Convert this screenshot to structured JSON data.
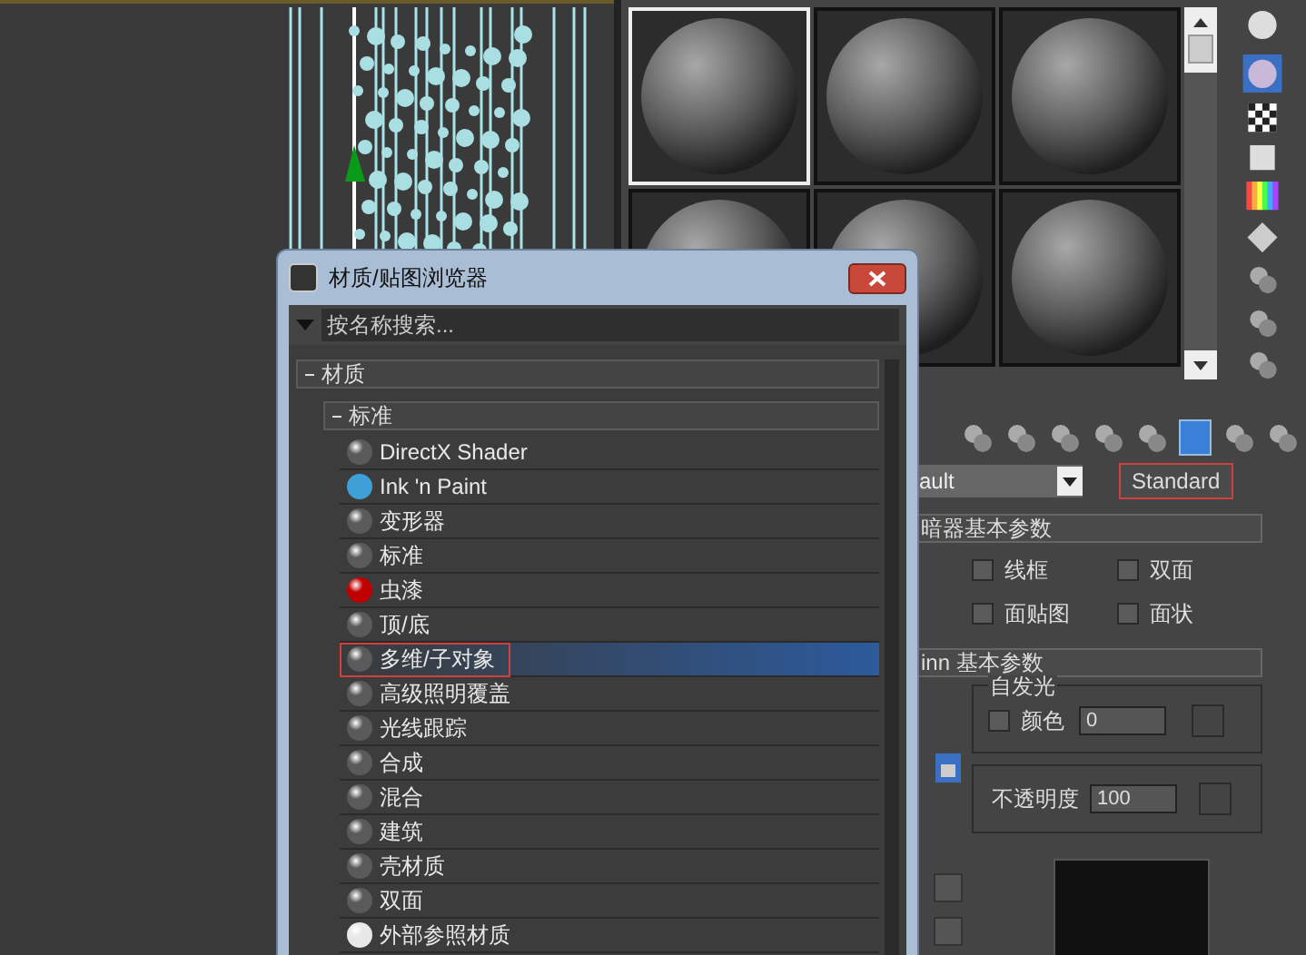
{
  "material_editor": {
    "sample_slots": [
      {
        "selected": true
      },
      {
        "selected": false
      },
      {
        "selected": false
      },
      {
        "selected": false
      },
      {
        "selected": false
      },
      {
        "selected": false
      }
    ],
    "name_field": {
      "value": "ault"
    },
    "type_button": {
      "label": "Standard",
      "highlighted": true
    },
    "shader_rollout": {
      "title": "暗器基本参数",
      "checkboxes": [
        {
          "label": "线框",
          "checked": false
        },
        {
          "label": "双面",
          "checked": false
        },
        {
          "label": "面贴图",
          "checked": false
        },
        {
          "label": "面状",
          "checked": false
        }
      ]
    },
    "basic_rollout": {
      "title": "inn 基本参数",
      "self_illumination": {
        "title": "自发光",
        "checkbox": {
          "label": "颜色",
          "checked": false
        },
        "value": "0"
      },
      "opacity": {
        "label": "不透明度",
        "value": "100"
      }
    }
  },
  "dialog": {
    "title": "材质/贴图浏览器",
    "search": {
      "placeholder": "按名称搜索..."
    },
    "groups": [
      {
        "label": "材质",
        "expanded": true,
        "children": [
          {
            "label": "标准",
            "expanded": true,
            "items": [
              {
                "label": "DirectX Shader",
                "kind": "sphere",
                "color": "#5a5a5a",
                "selected": false,
                "highlighted": false
              },
              {
                "label": "Ink 'n Paint",
                "kind": "flat",
                "color": "#3fa0d8",
                "selected": false,
                "highlighted": false
              },
              {
                "label": "变形器",
                "kind": "sphere",
                "color": "#5a5a5a",
                "selected": false,
                "highlighted": false
              },
              {
                "label": "标准",
                "kind": "sphere",
                "color": "#5a5a5a",
                "selected": false,
                "highlighted": false
              },
              {
                "label": "虫漆",
                "kind": "sphere",
                "color": "#c00000",
                "selected": false,
                "highlighted": false
              },
              {
                "label": "顶/底",
                "kind": "sphere",
                "color": "#5a5a5a",
                "selected": false,
                "highlighted": false
              },
              {
                "label": "多维/子对象",
                "kind": "sphere",
                "color": "#5a5a5a",
                "selected": true,
                "highlighted": true
              },
              {
                "label": "高级照明覆盖",
                "kind": "sphere",
                "color": "#5a5a5a",
                "selected": false,
                "highlighted": false
              },
              {
                "label": "光线跟踪",
                "kind": "sphere",
                "color": "#5a5a5a",
                "selected": false,
                "highlighted": false
              },
              {
                "label": "合成",
                "kind": "sphere",
                "color": "#5a5a5a",
                "selected": false,
                "highlighted": false
              },
              {
                "label": "混合",
                "kind": "sphere",
                "color": "#5a5a5a",
                "selected": false,
                "highlighted": false
              },
              {
                "label": "建筑",
                "kind": "sphere",
                "color": "#5a5a5a",
                "selected": false,
                "highlighted": false
              },
              {
                "label": "壳材质",
                "kind": "sphere",
                "color": "#5a5a5a",
                "selected": false,
                "highlighted": false
              },
              {
                "label": "双面",
                "kind": "sphere",
                "color": "#5a5a5a",
                "selected": false,
                "highlighted": false
              },
              {
                "label": "外部参照材质",
                "kind": "sphere",
                "color": "#e8e8e8",
                "selected": false,
                "highlighted": false
              }
            ]
          }
        ]
      }
    ]
  }
}
